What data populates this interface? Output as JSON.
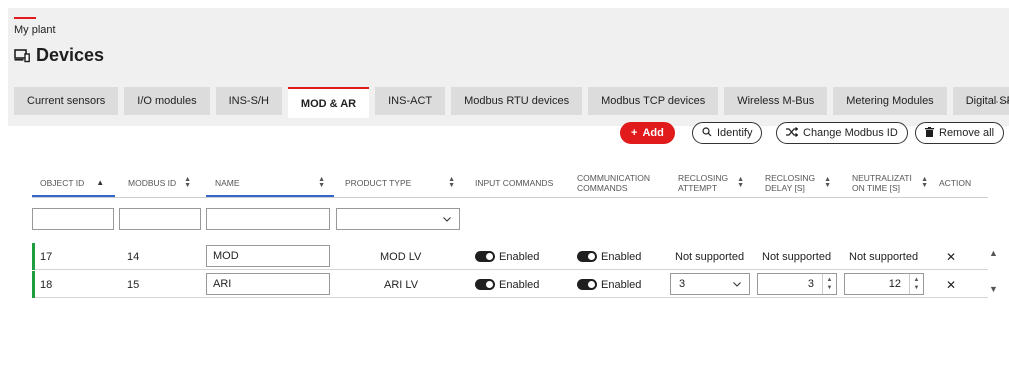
{
  "breadcrumb": "My plant",
  "page_title": "Devices",
  "tabs": [
    {
      "label": "Current sensors"
    },
    {
      "label": "I/O modules"
    },
    {
      "label": "INS-S/H"
    },
    {
      "label": "MOD & AR"
    },
    {
      "label": "INS-ACT"
    },
    {
      "label": "Modbus RTU devices"
    },
    {
      "label": "Modbus TCP devices"
    },
    {
      "label": "Wireless M-Bus"
    },
    {
      "label": "Metering Modules"
    },
    {
      "label": "Digital SPD"
    }
  ],
  "tabs_more": "···",
  "toolbar": {
    "add": "Add",
    "identify": "Identify",
    "change_modbus_id": "Change Modbus ID",
    "remove_all": "Remove all"
  },
  "columns": {
    "object_id": "OBJECT ID",
    "modbus_id": "MODBUS ID",
    "name": "NAME",
    "product_type": "PRODUCT TYPE",
    "input_commands": "INPUT COMMANDS",
    "communication_commands_1": "COMMUNICATION",
    "communication_commands_2": "COMMANDS",
    "reclosing_attempt_1": "RECLOSING",
    "reclosing_attempt_2": "ATTEMPT",
    "reclosing_delay_1": "RECLOSING",
    "reclosing_delay_2": "DELAY [S]",
    "neutralization_1": "NEUTRALIZATI",
    "neutralization_2": "ON TIME [S]",
    "action": "ACTION"
  },
  "rows": [
    {
      "object_id": "17",
      "modbus_id": "14",
      "name": "MOD",
      "product_type": "MOD LV",
      "input_commands": "Enabled",
      "communication_commands": "Enabled",
      "reclosing_attempt": "Not supported",
      "reclosing_delay": "Not supported",
      "neutralization_time": "Not supported",
      "action": "✕"
    },
    {
      "object_id": "18",
      "modbus_id": "15",
      "name": "ARI",
      "product_type": "ARI LV",
      "input_commands": "Enabled",
      "communication_commands": "Enabled",
      "reclosing_attempt": "3",
      "reclosing_delay": "3",
      "neutralization_time": "12",
      "action": "✕"
    }
  ],
  "colors": {
    "accent_red": "#e11b1b",
    "row_indicator": "#1e9e3e",
    "sort_underline": "#3366cc"
  },
  "icons": {
    "devices": "devices-icon",
    "add": "plus-icon",
    "identify": "search-icon",
    "change_modbus_id": "shuffle-icon",
    "remove_all": "trash-icon"
  }
}
